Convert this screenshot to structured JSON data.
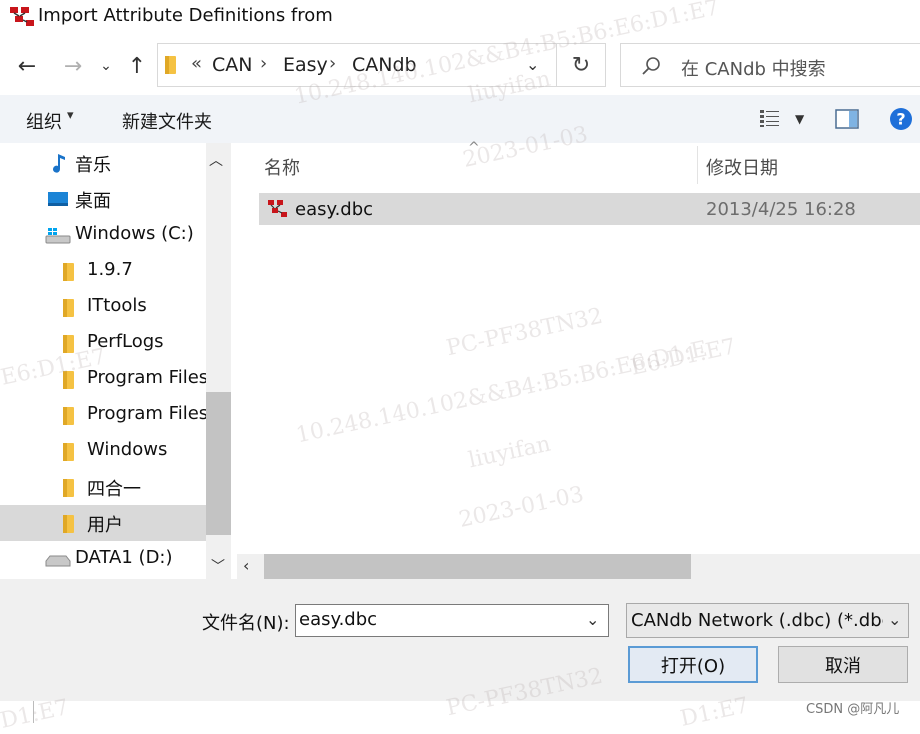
{
  "window": {
    "title": "Import Attribute Definitions from"
  },
  "address": {
    "overflow": "«",
    "crumbs": [
      "CAN",
      "Easy",
      "CANdb"
    ]
  },
  "search": {
    "placeholder": "在 CANdb 中搜索"
  },
  "toolbar": {
    "organize": "组织",
    "organize_caret": "▾",
    "new_folder": "新建文件夹"
  },
  "nav": {
    "items": [
      {
        "label": "音乐"
      },
      {
        "label": "桌面"
      },
      {
        "label": "Windows (C:)"
      },
      {
        "label": "1.9.7"
      },
      {
        "label": "ITtools"
      },
      {
        "label": "PerfLogs"
      },
      {
        "label": "Program Files"
      },
      {
        "label": "Program Files"
      },
      {
        "label": "Windows"
      },
      {
        "label": "四合一"
      },
      {
        "label": "用户"
      },
      {
        "label": "DATA1 (D:)"
      }
    ]
  },
  "files": {
    "columns": {
      "name": "名称",
      "modified": "修改日期"
    },
    "rows": [
      {
        "name": "easy.dbc",
        "modified": "2013/4/25 16:28"
      }
    ]
  },
  "bottom": {
    "filename_label": "文件名(N):",
    "filename_value": "easy.dbc",
    "filetype": "CANdb Network (.dbc) (*.dbc",
    "open": "打开(O)",
    "cancel": "取消"
  },
  "watermark": {
    "ip": "10.248.140.102&&B4:B5:B6:E6:D1:E7",
    "user": "liuyifan",
    "date": "2023-01-03",
    "host": "PC-PF38TN32",
    "mac_tail": "E6:D1:E7",
    "mac_tail_short": "D1:E7",
    "ip_partial": "10.248.140.102&&B4:B5:B6:E6:D1:E"
  },
  "footer": {
    "credit": "CSDN @阿凡儿"
  },
  "colors": {
    "accent": "#5b9bd5",
    "selection": "#d9d9d9",
    "help": "#1e6fd9",
    "folder": "#f5c243"
  }
}
